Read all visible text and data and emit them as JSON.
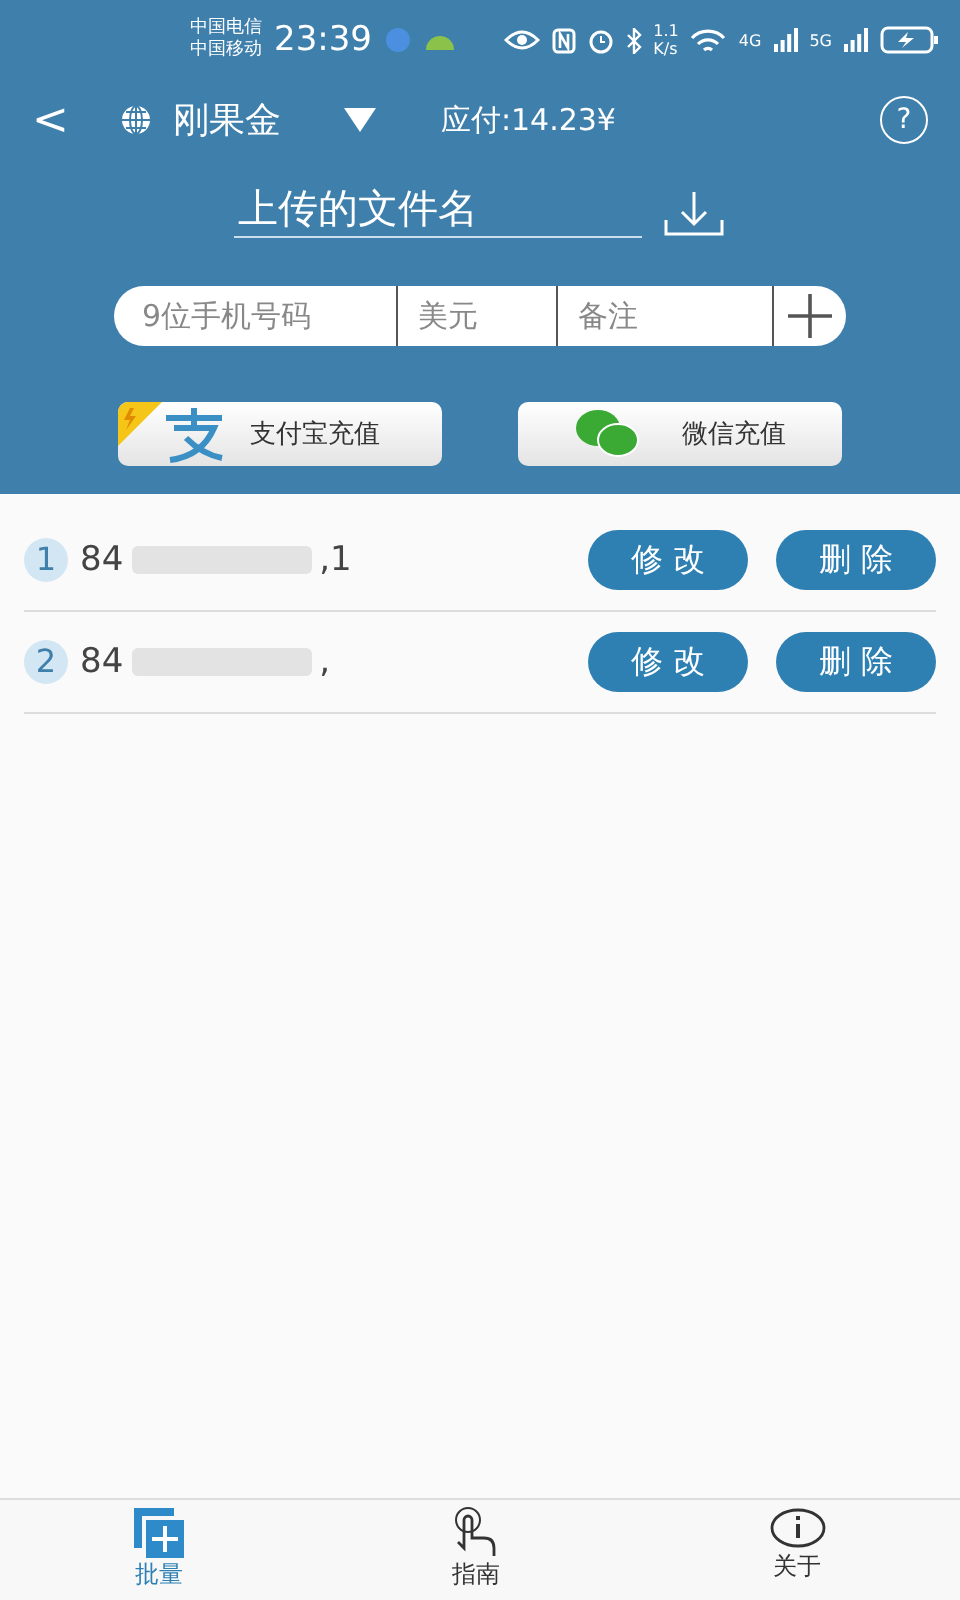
{
  "status_bar": {
    "carriers": [
      "中国电信",
      "中国移动"
    ],
    "time": "23:39",
    "speed": "1.1",
    "speed_unit": "K/s",
    "net1": "4G",
    "net2": "5G"
  },
  "header": {
    "back": "<",
    "account": "刚果金",
    "amount": "应付:14.23¥",
    "help": "?"
  },
  "file_name": {
    "placeholder": "上传的文件名"
  },
  "inputs": [
    {
      "placeholder": "9位手机号码"
    },
    {
      "placeholder": "美元"
    },
    {
      "placeholder": "备注"
    }
  ],
  "recharge_buttons": [
    {
      "kind": "alipay",
      "label": "支付宝充值"
    },
    {
      "kind": "wechat",
      "label": "微信充值"
    }
  ],
  "rows": [
    {
      "index": "1",
      "prefix": "84",
      "suffix": ",1",
      "edit": "修 改",
      "delete": "删 除"
    },
    {
      "index": "2",
      "prefix": "84",
      "suffix": ",",
      "edit": "修 改",
      "delete": "删 除"
    }
  ],
  "tabs": [
    {
      "kind": "batch",
      "label": "批量",
      "selected": true
    },
    {
      "kind": "guide",
      "label": "指南",
      "selected": false
    },
    {
      "kind": "about",
      "label": "关于",
      "selected": false
    }
  ]
}
